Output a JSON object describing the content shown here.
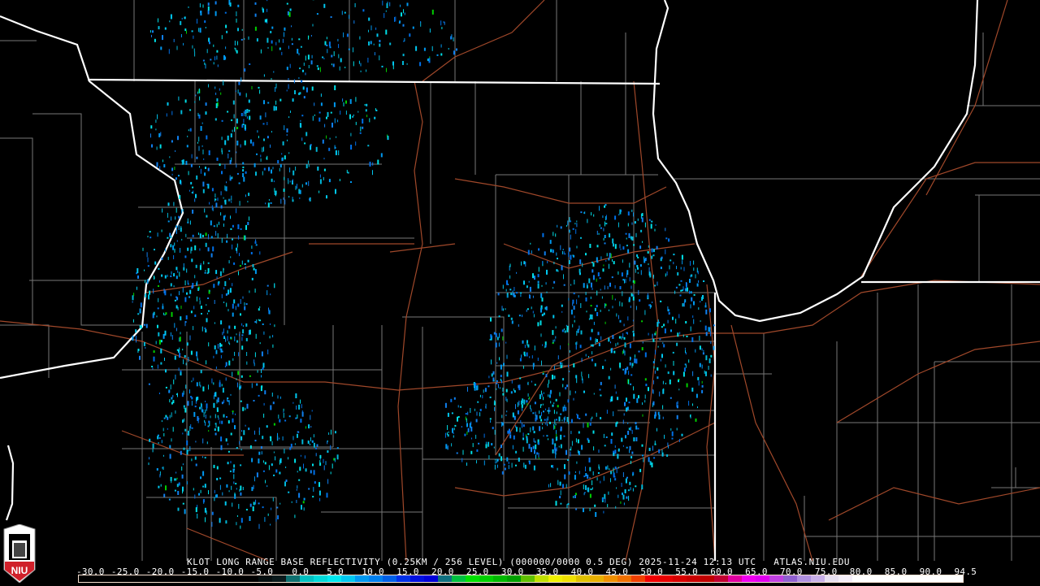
{
  "product": {
    "title": "KLOT LONG RANGE BASE REFLECTIVITY (0.25KM / 256 LEVEL) (000000/0000 0.5 DEG) 2025-11-24 12:13 UTC   ATLAS.NIU.EDU"
  },
  "legend": {
    "labels": [
      "-30.0",
      "-25.0",
      "-20.0",
      "-15.0",
      "-10.0",
      "-5.0",
      "0.0",
      "5.0",
      "10.0",
      "15.0",
      "20.0",
      "25.0",
      "30.0",
      "35.0",
      "40.0",
      "45.0",
      "50.0",
      "55.0",
      "60.0",
      "65.0",
      "70.0",
      "75.0",
      "80.0",
      "85.0",
      "90.0",
      "94.5"
    ],
    "colors": [
      "#000000",
      "#000000",
      "#000000",
      "#000000",
      "#000000",
      "#000000",
      "#000000",
      "#000000",
      "#000000",
      "#000000",
      "#000000",
      "#000000",
      "#000000",
      "#050f10",
      "#0a1a1c",
      "#0f7070",
      "#00c0c0",
      "#00d8d8",
      "#00e8f0",
      "#00c8f0",
      "#0098f0",
      "#0080f0",
      "#0060e8",
      "#0030e8",
      "#0010e0",
      "#0000d8",
      "#107080",
      "#00c040",
      "#00e000",
      "#00d000",
      "#00b800",
      "#00a000",
      "#60c000",
      "#c0e000",
      "#f0f000",
      "#f0e000",
      "#e0c000",
      "#e8b000",
      "#f09000",
      "#f07000",
      "#f04000",
      "#f00000",
      "#e80000",
      "#d80000",
      "#c80000",
      "#c00000",
      "#c00030",
      "#e000a0",
      "#f000f0",
      "#e000f0",
      "#c040e0",
      "#9060d0",
      "#b090e0",
      "#c8b0e8",
      "#e8e0f0",
      "#f4eef8",
      "#ffffff",
      "#ffffff",
      "#ffffff",
      "#ffffff",
      "#ffffff",
      "#ffffff",
      "#ffffff",
      "#ffffff"
    ]
  },
  "logo": {
    "text": "NIU"
  },
  "colors": {
    "border": "#ffffff",
    "county": "#808080",
    "road": "#b05020"
  }
}
